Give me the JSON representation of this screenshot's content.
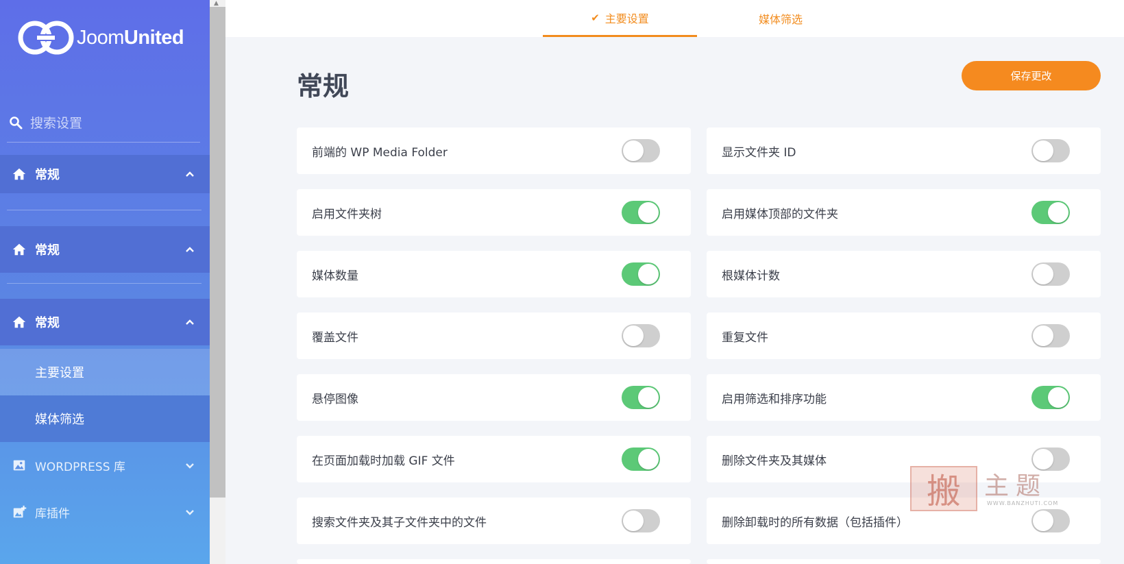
{
  "brand": {
    "logo_light": "Joom",
    "logo_bold": "United"
  },
  "sidebar": {
    "search_placeholder": "搜索设置",
    "sections": [
      {
        "label": "常规"
      },
      {
        "label": "常规"
      },
      {
        "label": "常规"
      }
    ],
    "sub_items": [
      {
        "label": "主要设置",
        "active": true
      },
      {
        "label": "媒体筛选",
        "active": false
      }
    ],
    "nav": [
      {
        "label": "WORDPRESS 库"
      },
      {
        "label": "库插件"
      }
    ]
  },
  "tabs": [
    {
      "label": "主要设置",
      "active": true
    },
    {
      "label": "媒体筛选",
      "active": false
    }
  ],
  "page": {
    "title": "常规",
    "save_label": "保存更改"
  },
  "settings": {
    "left": [
      {
        "label": "前端的 WP Media Folder",
        "on": false
      },
      {
        "label": "启用文件夹树",
        "on": true
      },
      {
        "label": "媒体数量",
        "on": true
      },
      {
        "label": "覆盖文件",
        "on": false
      },
      {
        "label": "悬停图像",
        "on": true
      },
      {
        "label": "在页面加载时加载 GIF 文件",
        "on": true
      },
      {
        "label": "搜索文件夹及其子文件夹中的文件",
        "on": false
      }
    ],
    "right": [
      {
        "label": "显示文件夹 ID",
        "on": false
      },
      {
        "label": "启用媒体顶部的文件夹",
        "on": true
      },
      {
        "label": "根媒体计数",
        "on": false
      },
      {
        "label": "重复文件",
        "on": false
      },
      {
        "label": "启用筛选和排序功能",
        "on": true
      },
      {
        "label": "删除文件夹及其媒体",
        "on": false
      },
      {
        "label": "删除卸载时的所有数据（包括插件）",
        "on": false
      }
    ]
  },
  "watermark": {
    "seal": "搬",
    "text": "主题",
    "url": "WWW.BANZHUTI.COM"
  },
  "colors": {
    "accent": "#f58a1f",
    "toggle_on": "#5cc977",
    "toggle_off": "#cfcfcf",
    "sidebar_top": "#5e6ee8",
    "sidebar_bottom": "#5aa6ec"
  }
}
